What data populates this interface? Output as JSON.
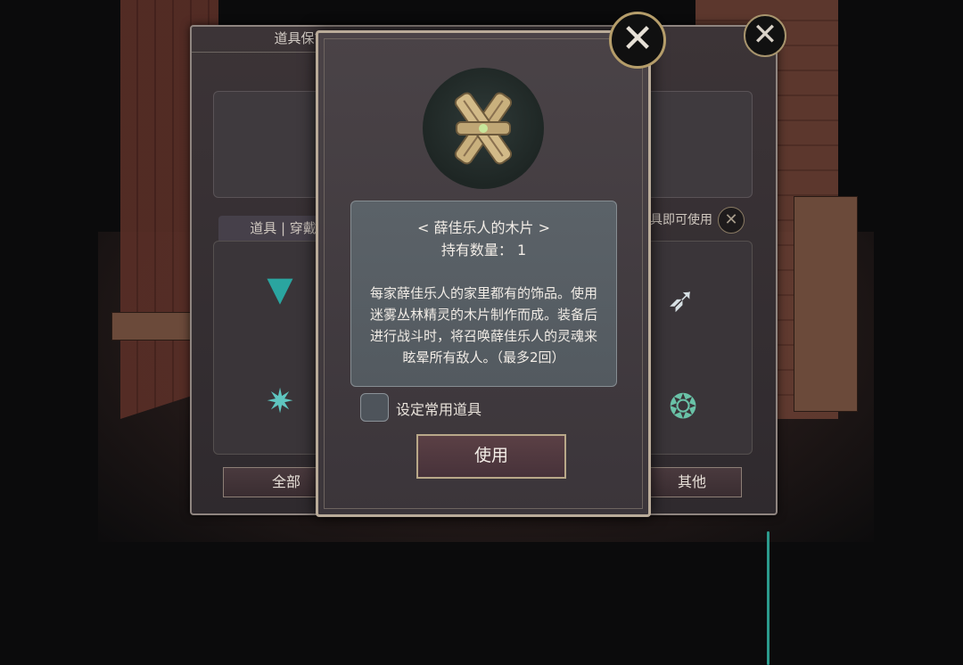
{
  "back_panel": {
    "title": "道具保管箱",
    "tabs_label": "道具 | 穿戴物",
    "use_only_label": "道具即可使用",
    "filters": {
      "all": "全部",
      "other": "其他"
    }
  },
  "modal": {
    "item_title": "< 薛佳乐人的木片 >",
    "quantity": "持有数量： 1",
    "description": "每家薛佳乐人的家里都有的饰品。使用迷雾丛林精灵的木片制作而成。装备后进行战斗时，将召唤薛佳乐人的灵魂来眩晕所有敌人。（最多2回）",
    "set_common_label": "设定常用道具",
    "use_button": "使用"
  }
}
